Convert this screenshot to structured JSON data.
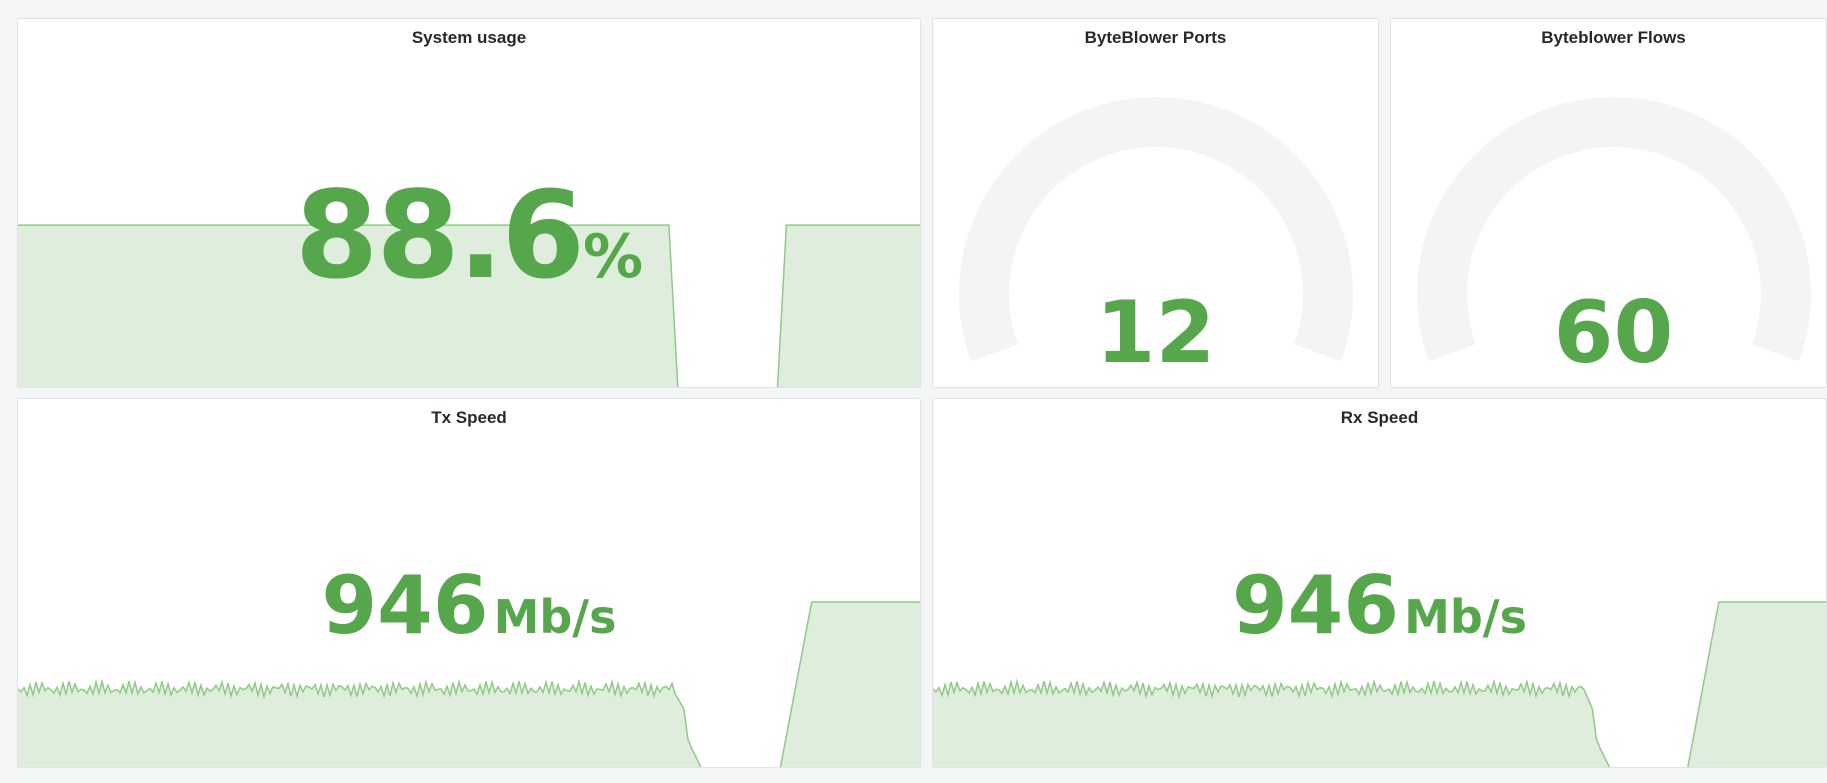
{
  "theme": {
    "accent": "#56a64b",
    "fill": "#dfeddd",
    "line": "#8fca86",
    "gauge_track": "#f3f4f4",
    "background": "#f4f5f5"
  },
  "panels": {
    "system_usage": {
      "title": "System usage",
      "value": "88.6",
      "unit": "%",
      "spark": [
        88.6,
        88.6,
        88.6,
        88.6,
        88.6,
        88.6,
        88.6,
        88.6,
        88.6,
        88.6,
        88.6,
        88.6,
        88.6,
        88.6,
        88.6,
        88.6,
        88.6,
        88.6,
        88.6,
        88.6,
        88.6,
        88.6,
        88.6,
        88.6,
        88.6,
        88.6,
        88.6,
        88.6,
        88.6,
        88.6,
        88.6,
        88.6,
        88.6,
        88.6,
        88.6,
        88.6,
        88.6,
        88.6,
        88.6,
        88.6,
        88.6,
        88.6,
        88.6,
        88.6,
        88.6,
        88.6,
        88.6,
        88.6,
        88.6,
        88.6,
        88.6,
        88.6,
        88.6,
        88.6,
        88.6,
        88.6,
        88.6,
        88.6,
        88.6,
        88.6,
        88.6,
        88.6,
        88.6,
        88.6,
        88.6,
        88.6,
        88.6,
        88.6,
        88.6,
        88.6,
        88.6,
        88.6,
        88.6,
        0,
        0,
        0,
        0,
        0,
        0,
        0,
        0,
        0,
        0,
        0,
        0,
        88.6,
        88.6,
        88.6,
        88.6,
        88.6,
        88.6,
        88.6,
        88.6,
        88.6,
        88.6,
        88.6,
        88.6,
        88.6,
        88.6,
        88.6,
        88.6
      ],
      "spark_max": 200
    },
    "byteblower_ports": {
      "title": "ByteBlower Ports",
      "value": "12",
      "gauge_fraction": 0.0
    },
    "byteblower_flows": {
      "title": "Byteblower Flows",
      "value": "60",
      "gauge_fraction": 0.0
    },
    "tx_speed": {
      "title": "Tx Speed",
      "value": "946",
      "unit": "Mb/s",
      "spark_max": 2000
    },
    "rx_speed": {
      "title": "Rx Speed",
      "value": "946",
      "unit": "Mb/s",
      "spark_max": 2000
    }
  }
}
